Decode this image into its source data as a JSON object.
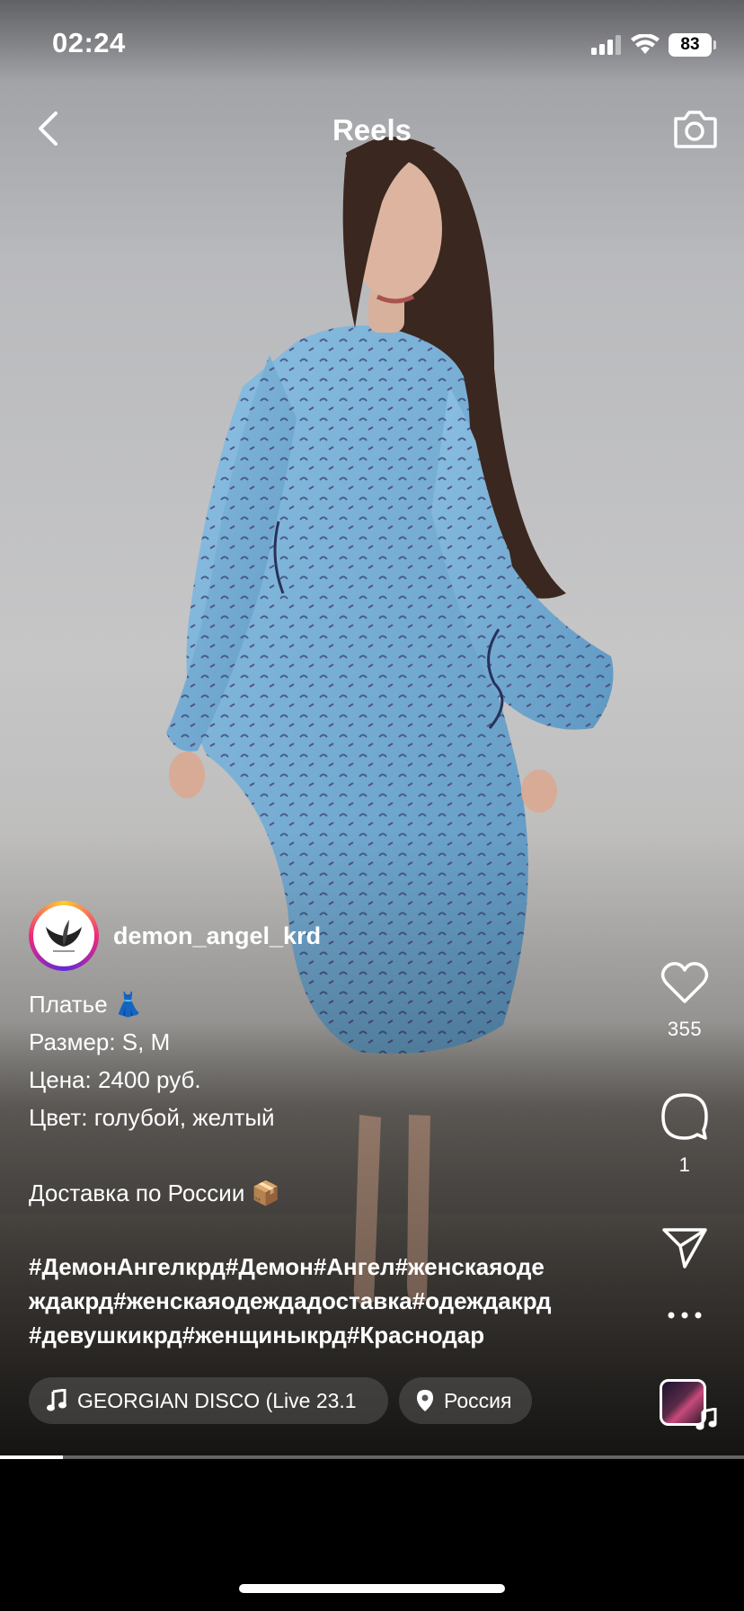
{
  "status_bar": {
    "time": "02:24",
    "battery": "83"
  },
  "header": {
    "title": "Reels",
    "back_icon": "chevron-left-icon",
    "camera_icon": "camera-icon"
  },
  "author": {
    "username": "demon_angel_krd"
  },
  "caption": {
    "lines": [
      "Платье 👗",
      "Размер: S, M",
      "Цена: 2400 руб.",
      "Цвет: голубой, желтый"
    ],
    "delivery": "Доставка по России 📦",
    "hashtag_lines": [
      "#ДемонАнгелкрд#Демон#Ангел#женскаяоде",
      "ждакрд#женскаяодеждадоставка#одеждакрд",
      "#девушкикрд#женщиныкрд#Краснодар"
    ]
  },
  "audio": {
    "label": "GEORGIAN DISCO (Live 23.1",
    "icon": "music-note-icon"
  },
  "location": {
    "label": "Россия",
    "icon": "location-pin-icon"
  },
  "actions": {
    "likes": "355",
    "comments": "1"
  },
  "playback": {
    "progress": 0.085
  },
  "colors": {
    "dress": "#7fb4d9",
    "hair": "#3a2720",
    "avatar_ring_start": "#f9ce34",
    "avatar_ring_end": "#6228d7"
  }
}
